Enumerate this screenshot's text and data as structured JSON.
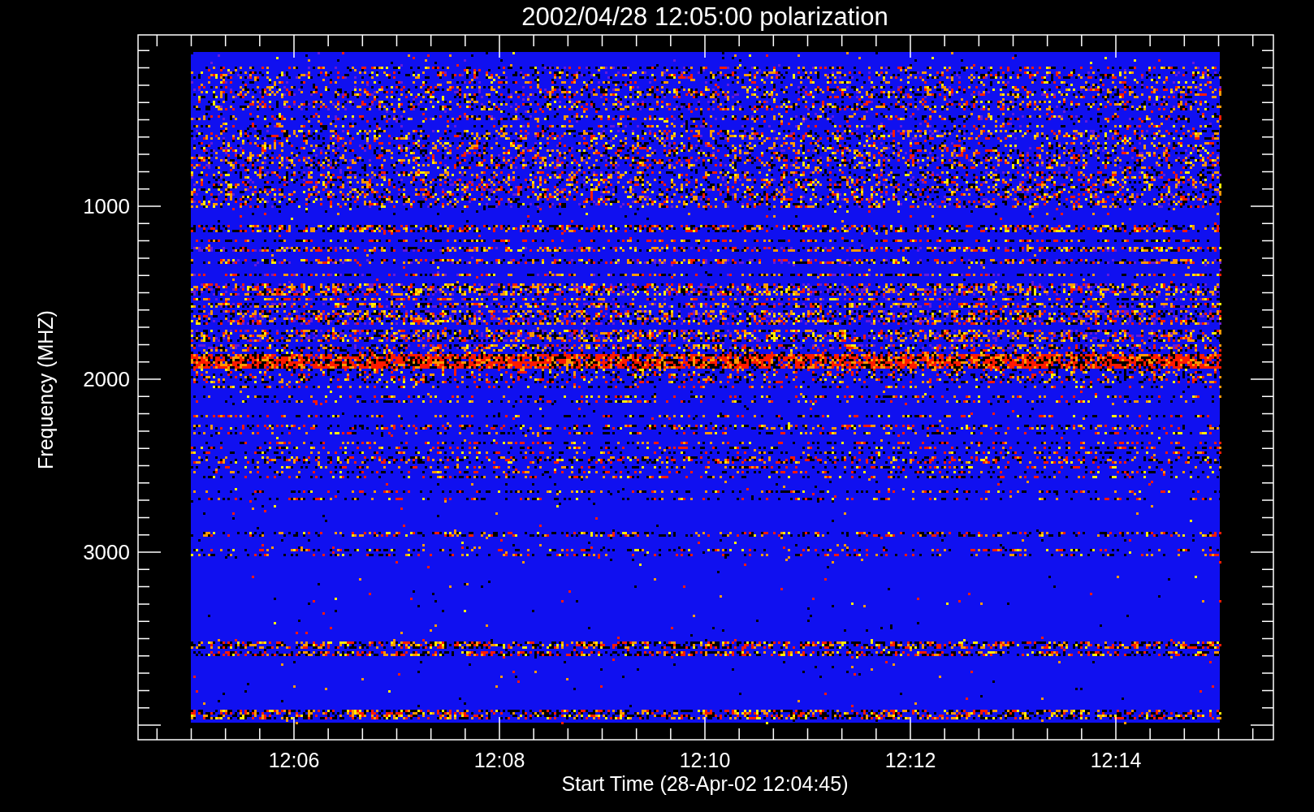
{
  "title": "2002/04/28 12:05:00 polarization",
  "plot": {
    "ylabel": "Frequency (MHZ)",
    "xlabel": "Start Time (28-Apr-02 12:04:45)",
    "yticks": [
      "1000",
      "2000",
      "3000"
    ],
    "xticks": [
      "12:06",
      "12:08",
      "12:10",
      "12:12",
      "12:14"
    ]
  }
}
